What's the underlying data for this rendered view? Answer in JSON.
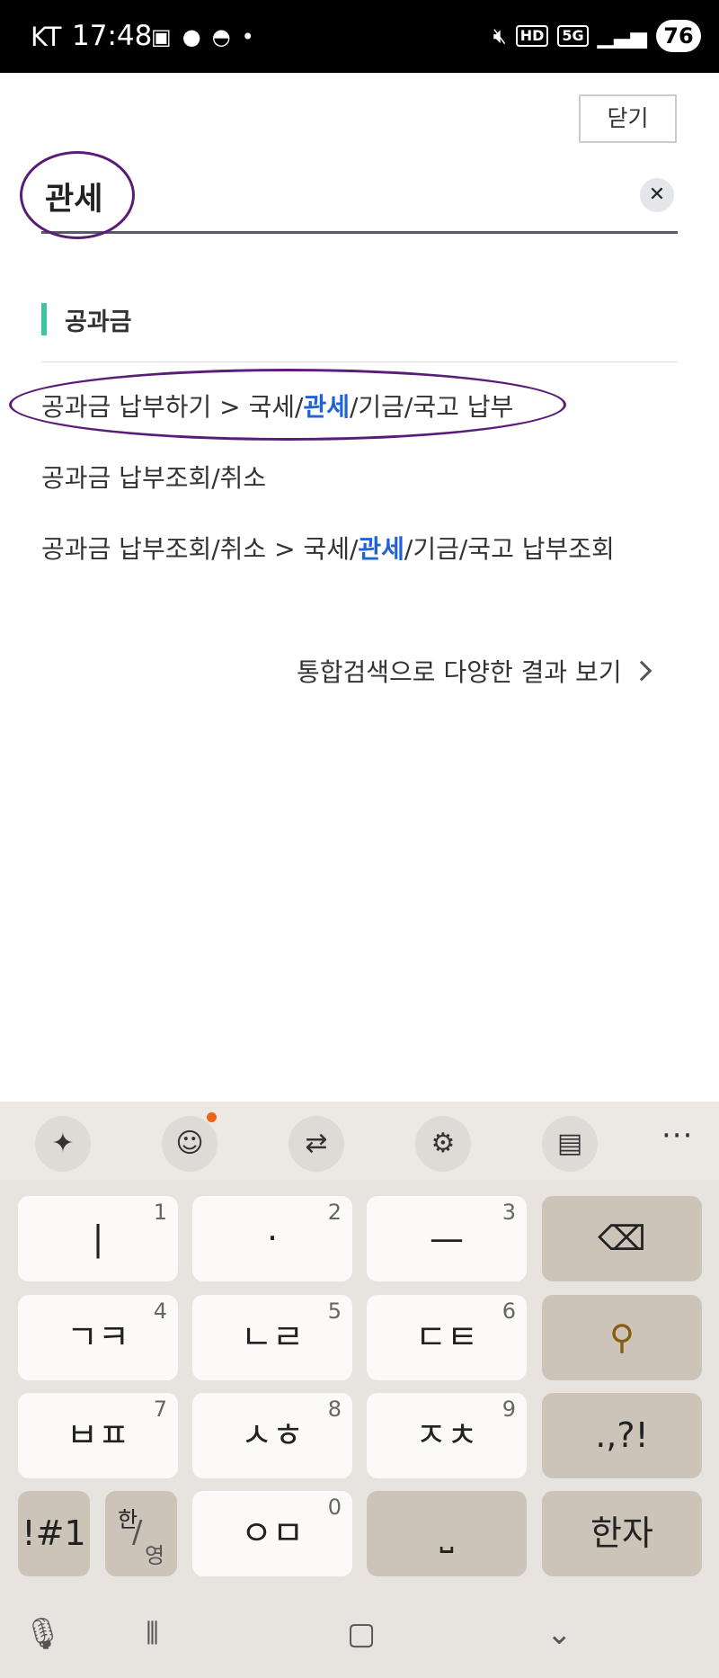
{
  "status_bar": {
    "carrier": "KT",
    "time": "17:48",
    "network": "5G",
    "hd": "HD",
    "battery": "76"
  },
  "header": {
    "close_label": "닫기"
  },
  "search": {
    "value": "관세",
    "clear_symbol": "✕"
  },
  "section": {
    "title": "공과금"
  },
  "results": [
    {
      "prefix": "공과금 납부하기 > 국세/",
      "highlight": "관세",
      "suffix": "/기금/국고 납부"
    },
    {
      "prefix": "공과금 납부조회/취소",
      "highlight": "",
      "suffix": ""
    },
    {
      "prefix": "공과금 납부조회/취소 > 국세/",
      "highlight": "관세",
      "suffix": "/기금/국고 납부조회"
    }
  ],
  "more_link": {
    "label": "통합검색으로 다양한 결과 보기"
  },
  "keyboard": {
    "toolbar_more": "···",
    "keys": {
      "k1": {
        "label": "|",
        "num": "1"
      },
      "k2": {
        "label": "·",
        "num": "2"
      },
      "k3": {
        "label": "—",
        "num": "3"
      },
      "k4": {
        "label": "ㄱㅋ",
        "num": "4"
      },
      "k5": {
        "label": "ㄴㄹ",
        "num": "5"
      },
      "k6": {
        "label": "ㄷㅌ",
        "num": "6"
      },
      "k7": {
        "label": "ㅂㅍ",
        "num": "7"
      },
      "k8": {
        "label": "ㅅㅎ",
        "num": "8"
      },
      "k9": {
        "label": "ㅈㅊ",
        "num": "9"
      },
      "k0": {
        "label": "ㅇㅁ",
        "num": "0"
      },
      "punct": ".,?!",
      "symbols": "!#1",
      "lang_top": "한",
      "lang_bottom": "영",
      "hanja": "한자",
      "space": "⎵"
    }
  },
  "colors": {
    "accent_highlight": "#1f63d6",
    "section_bar": "#3cc5a3",
    "annotation": "#5b1c78"
  }
}
